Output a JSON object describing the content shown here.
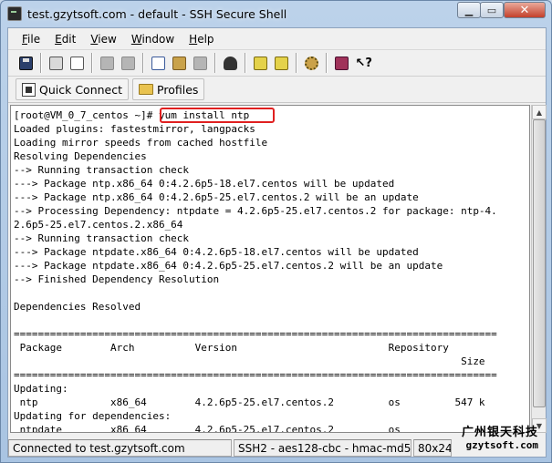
{
  "window": {
    "title": "test.gzytsoft.com - default - SSH Secure Shell"
  },
  "menu": {
    "items": [
      {
        "label": "File",
        "mnemonic": "F",
        "rest": "ile"
      },
      {
        "label": "Edit",
        "mnemonic": "E",
        "rest": "dit"
      },
      {
        "label": "View",
        "mnemonic": "V",
        "rest": "iew"
      },
      {
        "label": "Window",
        "mnemonic": "W",
        "rest": "indow"
      },
      {
        "label": "Help",
        "mnemonic": "H",
        "rest": "elp"
      }
    ]
  },
  "toolbar": {
    "icons": [
      "save-icon",
      "print-icon",
      "print-preview-icon",
      "disabled-icon",
      "disabled-icon",
      "copy-icon",
      "paste-icon",
      "disabled-icon",
      "find-icon",
      "settings-icon",
      "profile-settings-icon",
      "gear-icon",
      "help-book-icon",
      "context-help-icon"
    ]
  },
  "quickbar": {
    "quick_connect_label": "Quick Connect",
    "profiles_label": "Profiles"
  },
  "terminal": {
    "prompt": "[root@VM_0_7_centos ~]# ",
    "command": "yum install ntp",
    "lines": [
      "Loaded plugins: fastestmirror, langpacks",
      "Loading mirror speeds from cached hostfile",
      "Resolving Dependencies",
      "--> Running transaction check",
      "---> Package ntp.x86_64 0:4.2.6p5-18.el7.centos will be updated",
      "---> Package ntp.x86_64 0:4.2.6p5-25.el7.centos.2 will be an update",
      "--> Processing Dependency: ntpdate = 4.2.6p5-25.el7.centos.2 for package: ntp-4.",
      "2.6p5-25.el7.centos.2.x86_64",
      "--> Running transaction check",
      "---> Package ntpdate.x86_64 0:4.2.6p5-18.el7.centos will be updated",
      "---> Package ntpdate.x86_64 0:4.2.6p5-25.el7.centos.2 will be an update",
      "--> Finished Dependency Resolution",
      "",
      "Dependencies Resolved",
      "",
      "================================================================================",
      " Package        Arch          Version                         Repository",
      "                                                                          Size",
      "================================================================================",
      "Updating:",
      " ntp            x86_64        4.2.6p5-25.el7.centos.2         os         547 k",
      "Updating for dependencies:",
      " ntpdate        x86_64        4.2.6p5-25.el7.centos.2         os"
    ]
  },
  "status": {
    "connection": "Connected to test.gzytsoft.com",
    "cipher": "SSH2 - aes128-cbc - hmac-md5",
    "size": "80x24"
  },
  "watermark": {
    "chinese": "广州银天科技",
    "url": "gzytsoft.com"
  },
  "colors": {
    "highlight_box": "#e02020",
    "terminal_bg": "#ffffff"
  }
}
